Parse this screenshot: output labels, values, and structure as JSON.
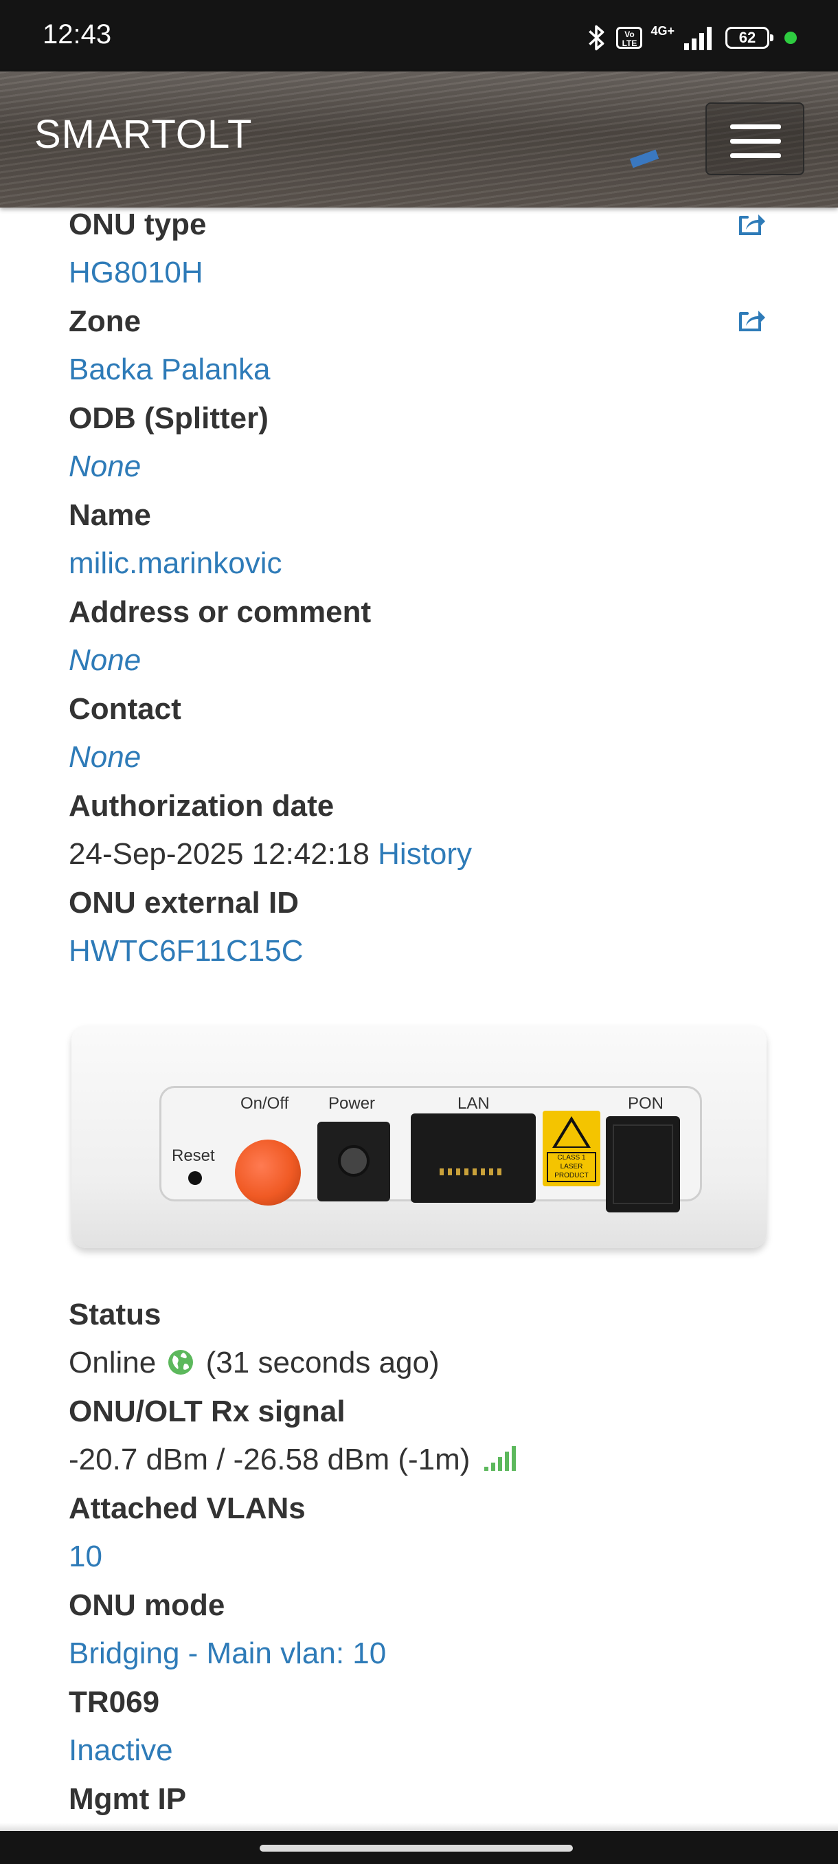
{
  "status_bar": {
    "time": "12:43",
    "network_type": "4G+",
    "volte_label": "Vo LTE",
    "battery": "62",
    "colors": {
      "background": "#141414",
      "dot": "#2ecc40"
    }
  },
  "header": {
    "brand": "SMARTOLT",
    "menu_icon": "hamburger-menu-icon"
  },
  "fields": {
    "onu_type": {
      "label": "ONU type",
      "value": "HG8010H"
    },
    "zone": {
      "label": "Zone",
      "value": "Backa Palanka"
    },
    "odb": {
      "label": "ODB (Splitter)",
      "value": "None"
    },
    "name": {
      "label": "Name",
      "value": "milic.marinkovic"
    },
    "address": {
      "label": "Address or comment",
      "value": "None"
    },
    "contact": {
      "label": "Contact",
      "value": "None"
    },
    "authorization_date": {
      "label": "Authorization date",
      "value": "24-Sep-2025 12:42:18",
      "history_link": "History"
    },
    "external_id": {
      "label": "ONU external ID",
      "value": "HWTC6F11C15C"
    },
    "status": {
      "label": "Status",
      "value": "Online",
      "ago": "(31 seconds ago)"
    },
    "rx_signal": {
      "label": "ONU/OLT Rx signal",
      "value": "-20.7 dBm / -26.58 dBm (-1m)"
    },
    "vlans": {
      "label": "Attached VLANs",
      "value": "10"
    },
    "onu_mode": {
      "label": "ONU mode",
      "value": "Bridging - Main vlan: 10"
    },
    "tr069": {
      "label": "TR069",
      "value": "Inactive"
    },
    "mgmt_ip": {
      "label": "Mgmt IP"
    }
  },
  "device_image": {
    "labels": {
      "reset": "Reset",
      "onoff": "On/Off",
      "power": "Power",
      "lan": "LAN",
      "pon": "PON",
      "laser": "CLASS 1 LASER PRODUCT"
    }
  },
  "colors": {
    "link": "#2e7bb8",
    "label": "#333333",
    "signal_green": "#5cb85c"
  }
}
